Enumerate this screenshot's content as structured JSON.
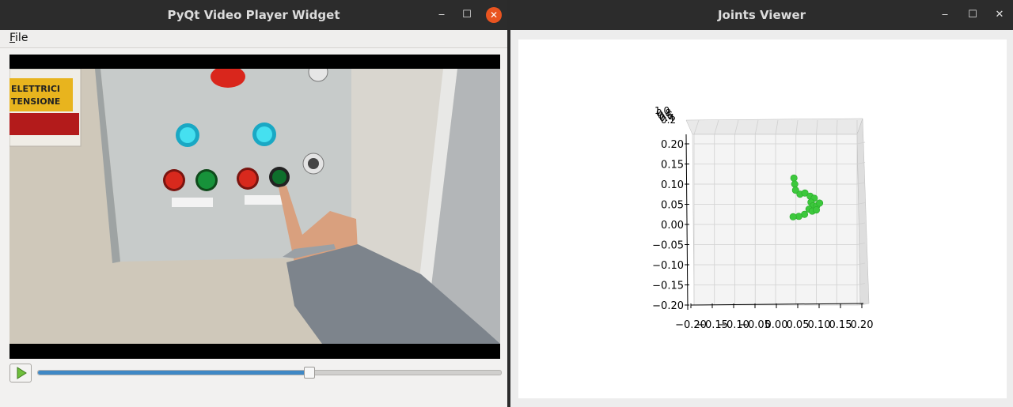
{
  "video_window": {
    "title": "PyQt Video Player Widget",
    "controls": {
      "minimize": "‒",
      "maximize": "☐",
      "close": "✕"
    },
    "menu": {
      "file": "File"
    },
    "video": {
      "sign_text_line1": "ELETTRICI",
      "sign_text_line2": "TENSIONE"
    },
    "playback": {
      "progress_fraction": 0.585
    }
  },
  "joints_window": {
    "title": "Joints Viewer",
    "controls": {
      "minimize": "‒",
      "maximize": "☐",
      "close": "✕"
    },
    "plot": {
      "type": "scatter",
      "ytick_labels": [
        "0.20",
        "0.15",
        "0.10",
        "0.05",
        "0.00",
        "−0.05",
        "−0.10",
        "−0.15",
        "−0.20"
      ],
      "xtick_labels": [
        "−0.20",
        "−0.15",
        "−0.10",
        "−0.05",
        "0.00",
        "0.05",
        "0.10",
        "0.15",
        "0.20"
      ],
      "overlapping_top_labels": [
        "1.0",
        "0.8",
        "0.6",
        "0.4",
        "0.2"
      ],
      "point_color": "#3cc83c",
      "xlim": [
        -0.2,
        0.2
      ],
      "ylim": [
        -0.2,
        0.2
      ]
    }
  },
  "chart_data": {
    "type": "scatter",
    "xlim": [
      -0.2,
      0.2
    ],
    "ylim": [
      -0.2,
      0.2
    ],
    "series": [
      {
        "points": [
          [
            0.045,
            0.115
          ],
          [
            0.047,
            0.1
          ],
          [
            0.049,
            0.085
          ],
          [
            0.06,
            0.075
          ],
          [
            0.072,
            0.078
          ],
          [
            0.085,
            0.07
          ],
          [
            0.095,
            0.065
          ],
          [
            0.087,
            0.055
          ],
          [
            0.092,
            0.046
          ],
          [
            0.101,
            0.046
          ],
          [
            0.108,
            0.053
          ],
          [
            0.082,
            0.038
          ],
          [
            0.09,
            0.033
          ],
          [
            0.1,
            0.036
          ],
          [
            0.071,
            0.025
          ],
          [
            0.057,
            0.02
          ],
          [
            0.043,
            0.019
          ]
        ]
      }
    ]
  }
}
